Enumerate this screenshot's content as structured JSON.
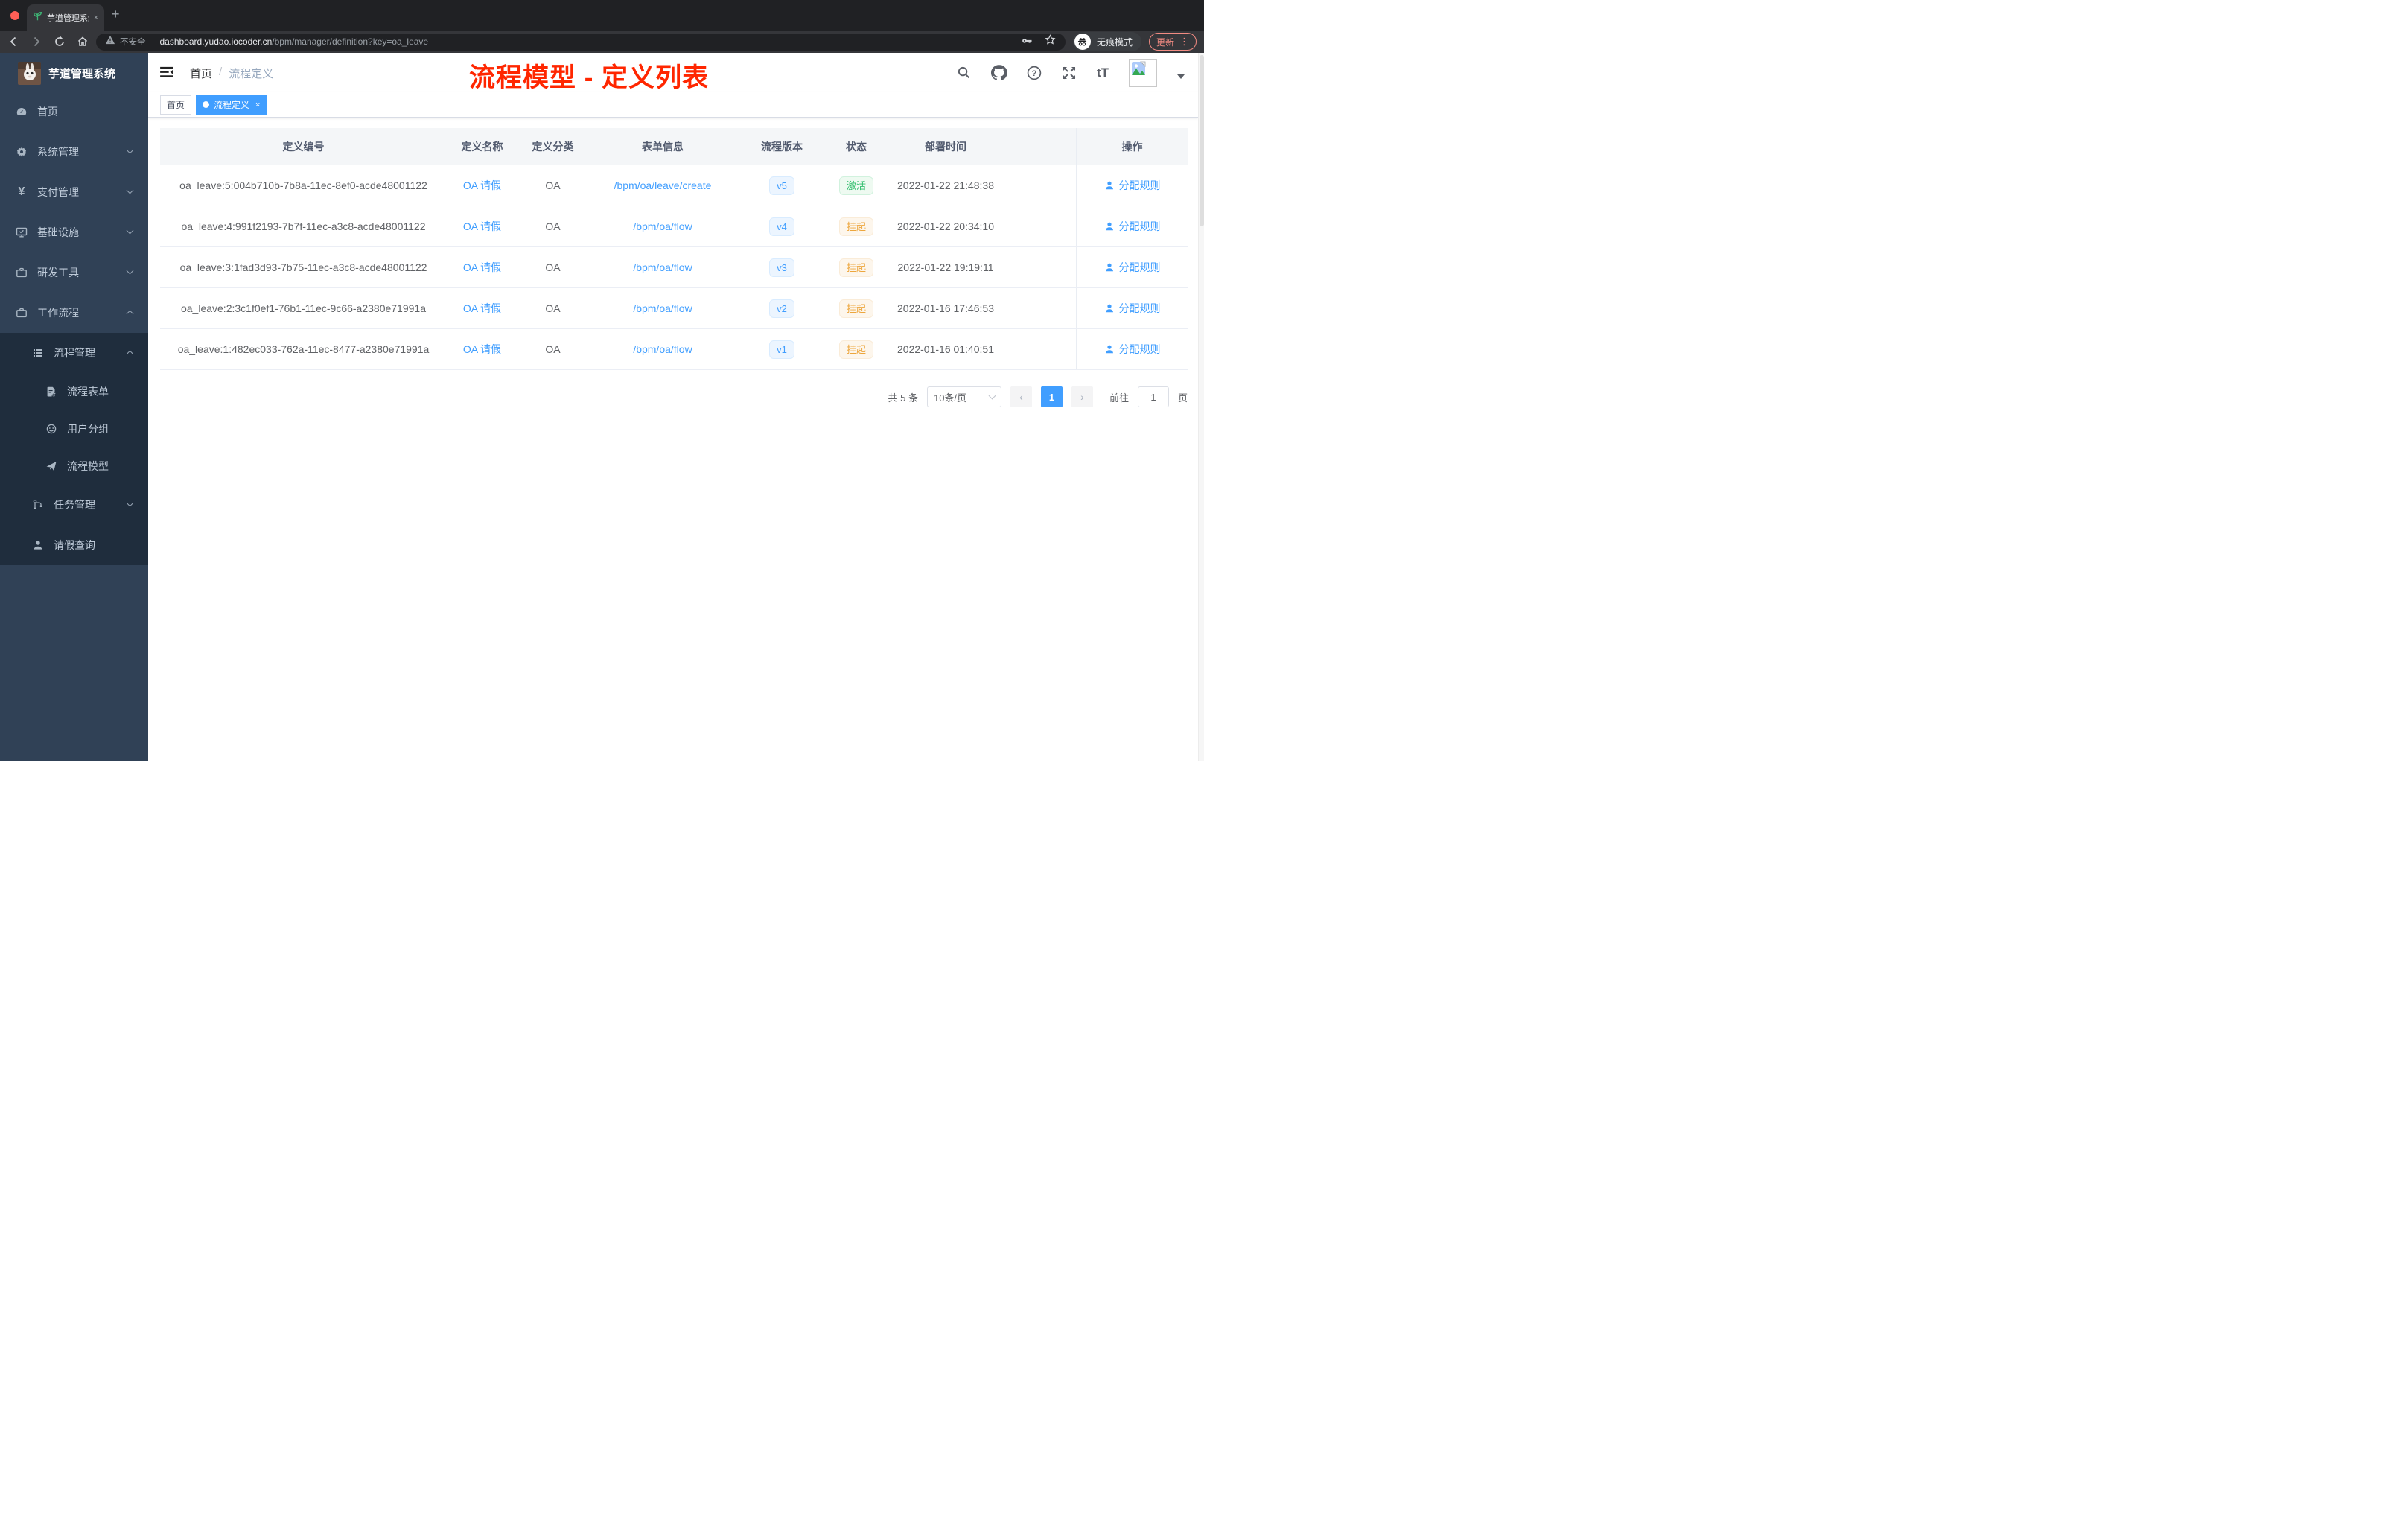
{
  "browser": {
    "tab_title": "芋道管理系统",
    "tab_close": "×",
    "new_tab": "+",
    "security_label": "不安全",
    "url_host": "dashboard.yudao.iocoder.cn",
    "url_path": "/bpm/manager/definition?key=oa_leave",
    "incognito_label": "无痕模式",
    "update_label": "更新",
    "menu_dots": "⋮"
  },
  "sidebar": {
    "app_title": "芋道管理系统",
    "items": [
      {
        "label": "首页",
        "icon": "dashboard-icon",
        "level": 1
      },
      {
        "label": "系统管理",
        "icon": "gear-icon",
        "level": 1,
        "chevron": "down"
      },
      {
        "label": "支付管理",
        "icon": "yen-icon",
        "level": 1,
        "chevron": "down"
      },
      {
        "label": "基础设施",
        "icon": "monitor-icon",
        "level": 1,
        "chevron": "down"
      },
      {
        "label": "研发工具",
        "icon": "briefcase-icon",
        "level": 1,
        "chevron": "down"
      },
      {
        "label": "工作流程",
        "icon": "briefcase-icon",
        "level": 1,
        "chevron": "up"
      },
      {
        "label": "流程管理",
        "icon": "list-icon",
        "level": 2,
        "chevron": "up"
      },
      {
        "label": "流程表单",
        "icon": "form-doc-icon",
        "level": 3
      },
      {
        "label": "用户分组",
        "icon": "face-icon",
        "level": 3
      },
      {
        "label": "流程模型",
        "icon": "send-icon",
        "level": 3
      },
      {
        "label": "任务管理",
        "icon": "flow-icon",
        "level": 2,
        "chevron": "down"
      },
      {
        "label": "请假查询",
        "icon": "user-icon",
        "level": 2
      }
    ]
  },
  "navbar": {
    "breadcrumb": {
      "home": "首页",
      "separator": "/",
      "current": "流程定义"
    },
    "icons": [
      "search-icon",
      "github-icon",
      "question-icon",
      "fullscreen-icon",
      "font-size-icon",
      "avatar",
      "caret-down-icon"
    ],
    "font_size_glyph": "tT"
  },
  "annotation": "流程模型 - 定义列表",
  "tags": [
    {
      "label": "首页",
      "active": false
    },
    {
      "label": "流程定义",
      "active": true,
      "close": "×"
    }
  ],
  "table": {
    "columns": [
      "定义编号",
      "定义名称",
      "定义分类",
      "表单信息",
      "流程版本",
      "状态",
      "部署时间",
      "操作"
    ],
    "rows": [
      {
        "id": "oa_leave:5:004b710b-7b8a-11ec-8ef0-acde48001122",
        "name": "OA 请假",
        "category": "OA",
        "form": "/bpm/oa/leave/create",
        "version": "v5",
        "status": "激活",
        "status_type": "success",
        "deployed_at": "2022-01-22 21:48:38",
        "action": "分配规则"
      },
      {
        "id": "oa_leave:4:991f2193-7b7f-11ec-a3c8-acde48001122",
        "name": "OA 请假",
        "category": "OA",
        "form": "/bpm/oa/flow",
        "version": "v4",
        "status": "挂起",
        "status_type": "warning",
        "deployed_at": "2022-01-22 20:34:10",
        "action": "分配规则"
      },
      {
        "id": "oa_leave:3:1fad3d93-7b75-11ec-a3c8-acde48001122",
        "name": "OA 请假",
        "category": "OA",
        "form": "/bpm/oa/flow",
        "version": "v3",
        "status": "挂起",
        "status_type": "warning",
        "deployed_at": "2022-01-22 19:19:11",
        "action": "分配规则"
      },
      {
        "id": "oa_leave:2:3c1f0ef1-76b1-11ec-9c66-a2380e71991a",
        "name": "OA 请假",
        "category": "OA",
        "form": "/bpm/oa/flow",
        "version": "v2",
        "status": "挂起",
        "status_type": "warning",
        "deployed_at": "2022-01-16 17:46:53",
        "action": "分配规则"
      },
      {
        "id": "oa_leave:1:482ec033-762a-11ec-8477-a2380e71991a",
        "name": "OA 请假",
        "category": "OA",
        "form": "/bpm/oa/flow",
        "version": "v1",
        "status": "挂起",
        "status_type": "warning",
        "deployed_at": "2022-01-16 01:40:51",
        "action": "分配规则"
      }
    ]
  },
  "pagination": {
    "total_label": "共 5 条",
    "page_size": "10条/页",
    "prev": "‹",
    "current_page": "1",
    "next": "›",
    "goto_label": "前往",
    "goto_value": "1",
    "page_unit": "页"
  },
  "colors": {
    "accent_blue": "#409eff",
    "sidebar_bg": "#304156",
    "submenu_bg": "#1f2d3d",
    "annotation_red": "#ff2600",
    "success_green": "#2ebd6b",
    "warning_orange": "#eda63c",
    "chrome_update_salmon": "#f28b82"
  }
}
